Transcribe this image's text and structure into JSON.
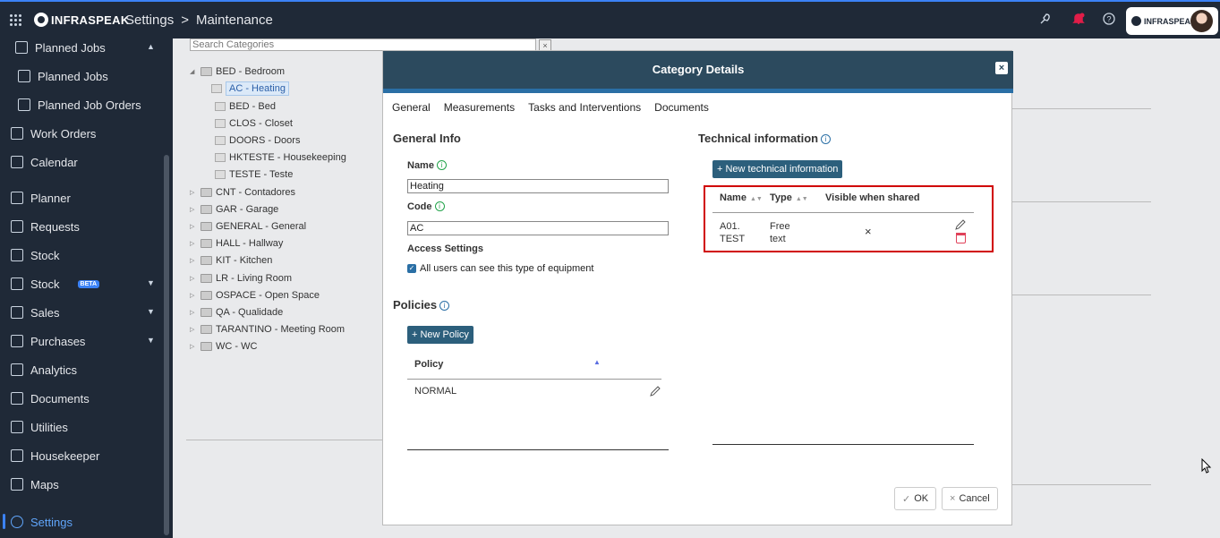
{
  "topbar": {
    "brand": "INFRASPEAK",
    "crumb_root": "Settings",
    "crumb_sep": ">",
    "crumb_page": "Maintenance",
    "user_brand": "INFRASPEAK",
    "icons": [
      "grid-icon",
      "rocket-icon",
      "bell-icon",
      "help-icon"
    ]
  },
  "sidebar": {
    "items": [
      {
        "label": "Planned Jobs"
      },
      {
        "label": "Planned Jobs"
      },
      {
        "label": "Planned Job Orders"
      },
      {
        "label": "Work Orders"
      },
      {
        "label": "Calendar"
      },
      {
        "label": "Planner"
      },
      {
        "label": "Requests"
      },
      {
        "label": "Stock"
      },
      {
        "label": "Stock",
        "badge": "BETA"
      },
      {
        "label": "Sales"
      },
      {
        "label": "Purchases"
      },
      {
        "label": "Analytics"
      },
      {
        "label": "Documents"
      },
      {
        "label": "Utilities"
      },
      {
        "label": "Housekeeper"
      },
      {
        "label": "Maps"
      },
      {
        "label": "Settings"
      }
    ]
  },
  "tree": {
    "search_placeholder": "Search Categories",
    "close": "×",
    "nodes": [
      "BED - Bedroom",
      "AC - Heating",
      "BED - Bed",
      "CLOS - Closet",
      "DOORS - Doors",
      "HKTESTE - Housekeeping",
      "TESTE - Teste",
      "CNT - Contadores",
      "GAR - Garage",
      "GENERAL - General",
      "HALL - Hallway",
      "KIT - Kitchen",
      "LR - Living Room",
      "OSPACE - Open Space",
      "QA - Qualidade",
      "TARANTINO - Meeting Room",
      "WC - WC"
    ]
  },
  "modal": {
    "title": "Category Details",
    "close": "×",
    "tabs": [
      "General",
      "Measurements",
      "Tasks and Interventions",
      "Documents"
    ],
    "general_info": {
      "title": "General Info",
      "name_label": "Name",
      "name_value": "Heating",
      "code_label": "Code",
      "code_value": "AC",
      "access_title": "Access Settings",
      "access_check": "All users can see this type of equipment"
    },
    "policies": {
      "title": "Policies",
      "new_button": "+ New Policy",
      "col": "Policy",
      "rows": [
        "NORMAL"
      ]
    },
    "technical": {
      "title": "Technical information",
      "new_button": "+ New technical information",
      "cols": [
        "Name",
        "Type",
        "Visible when shared"
      ],
      "row": {
        "name_l1": "A01.",
        "name_l2": "TEST",
        "type_l1": "Free",
        "type_l2": "text",
        "visible": "×"
      }
    },
    "footer": {
      "ok": "OK",
      "cancel": "Cancel"
    }
  }
}
